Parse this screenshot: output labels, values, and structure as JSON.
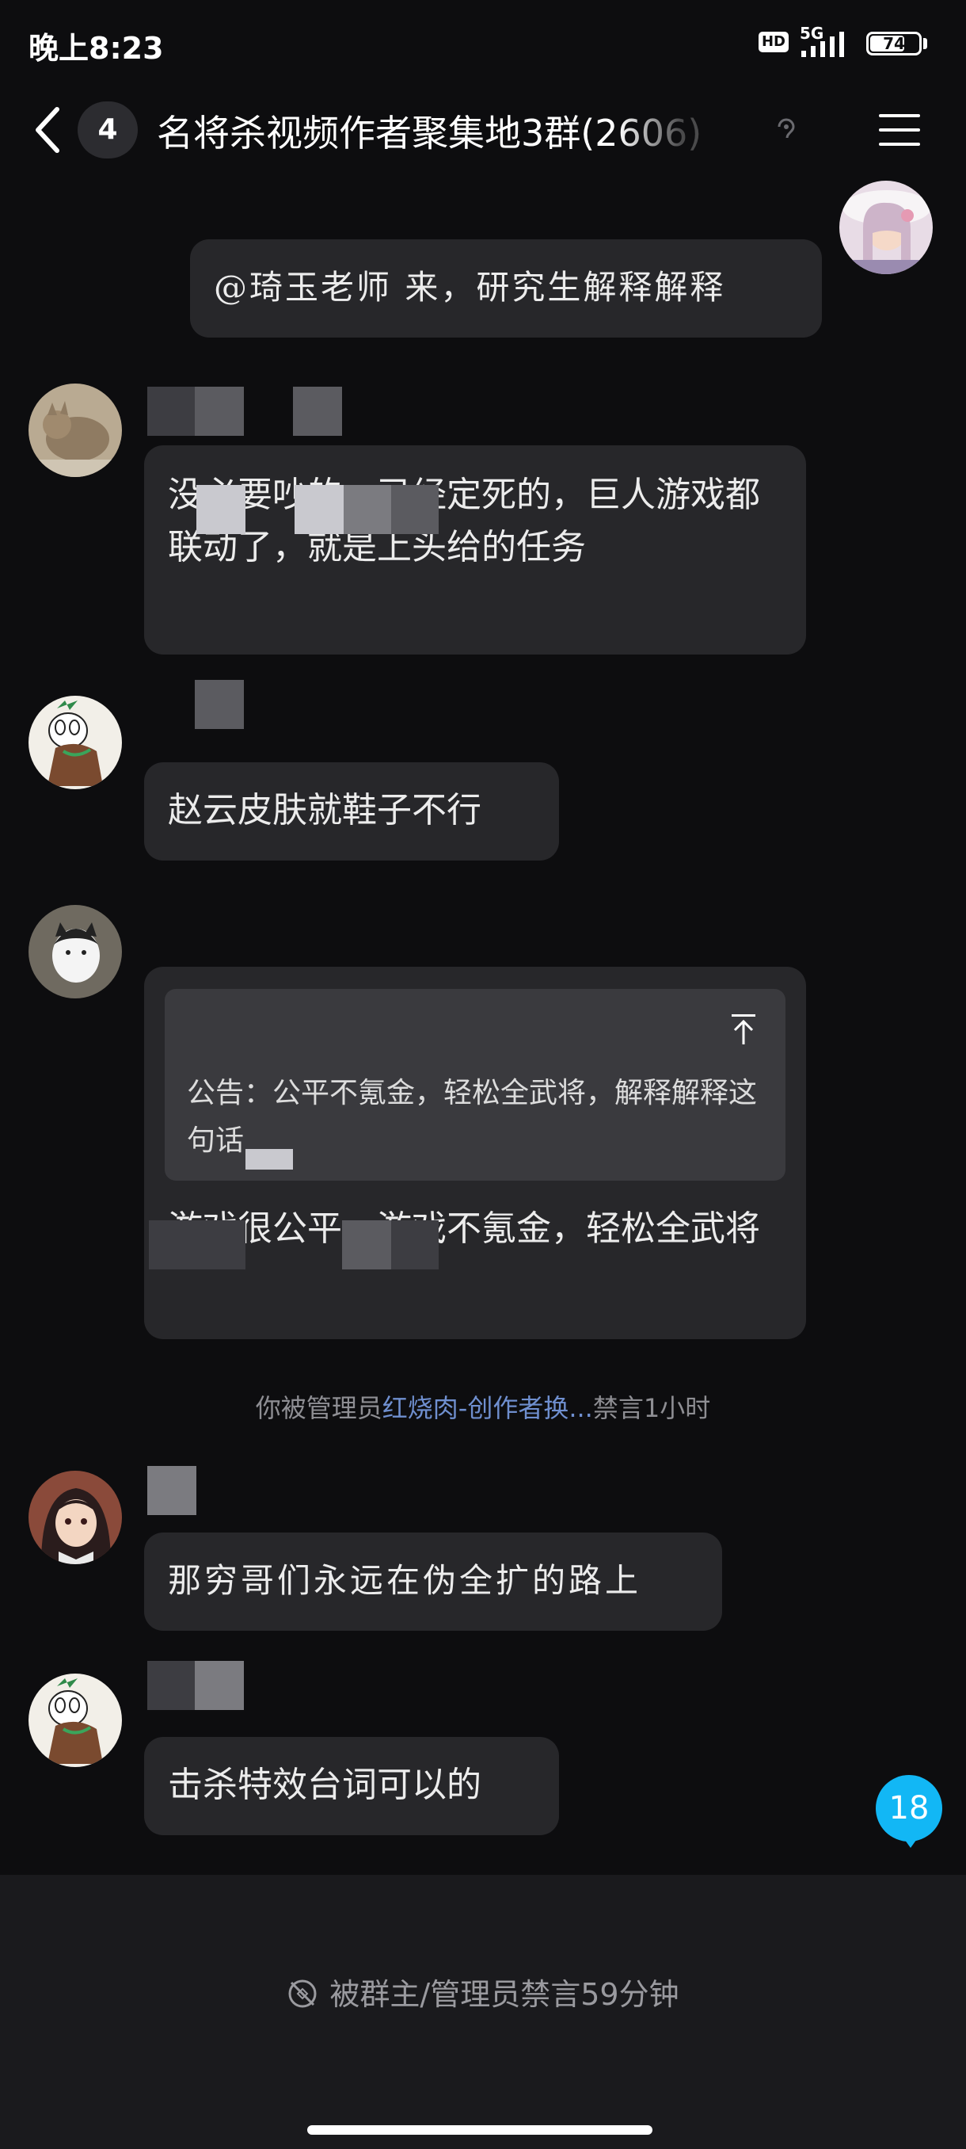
{
  "status_bar": {
    "time": "晚上8:23",
    "hd": "HD",
    "network": "5G",
    "battery": "74",
    "battery_level": 0.74
  },
  "header": {
    "unread_count": "4",
    "title": "名将杀视频作者聚集地3群(2606)",
    "menu_icon": "menu-icon",
    "back_icon": "chevron-left-icon"
  },
  "messages": [
    {
      "side": "right",
      "text": "@琦玉老师 来，研究生解释解释"
    },
    {
      "side": "left",
      "text": "没必要吵的，已经定死的，巨人游戏都联动了，就是上头给的任务"
    },
    {
      "side": "left",
      "text": "赵云皮肤就鞋子不行"
    },
    {
      "side": "left",
      "quote": "公告：公平不氪金，轻松全武将，解释解释这句话",
      "text": "游戏很公平，游戏不氪金，轻松全武将"
    },
    {
      "side": "left",
      "text": "那穷哥们永远在伪全扩的路上"
    },
    {
      "side": "left",
      "text": "击杀特效台词可以的"
    }
  ],
  "system": {
    "prefix": "你被管理员",
    "admin": "红烧肉-创作者换...",
    "suffix": "禁言1小时"
  },
  "new_message_badge": "18",
  "footer": {
    "mute_text": "被群主/管理员禁言59分钟"
  },
  "colors": {
    "background": "#0d0d0f",
    "bubble": "#27272a",
    "accent": "#12b7f5",
    "link": "#6f8fcf"
  }
}
